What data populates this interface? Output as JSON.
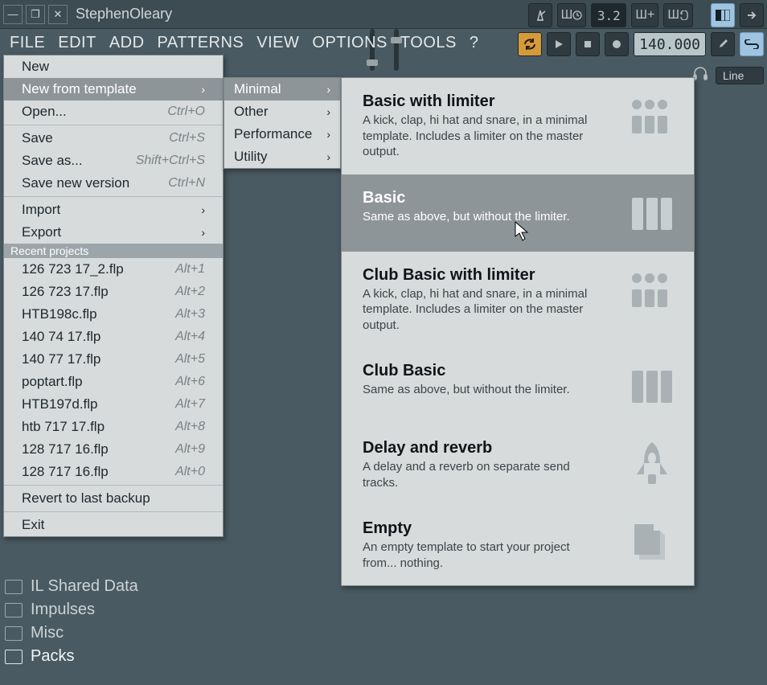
{
  "window": {
    "title": "StephenOleary",
    "min_glyph": "—",
    "max_glyph": "❐",
    "close_glyph": "✕"
  },
  "toolbar": {
    "tempo": "140.000",
    "pattern_display": "3.2",
    "output_label": "Line"
  },
  "menubar": [
    "FILE",
    "EDIT",
    "ADD",
    "PATTERNS",
    "VIEW",
    "OPTIONS",
    "TOOLS",
    "?"
  ],
  "file_menu": {
    "items": [
      {
        "label": "New",
        "key": "",
        "chev": false
      },
      {
        "label": "New from template",
        "key": "",
        "chev": true,
        "highlight": true
      },
      {
        "label": "Open...",
        "key": "Ctrl+O",
        "chev": false
      },
      {
        "sep": true
      },
      {
        "label": "Save",
        "key": "Ctrl+S",
        "chev": false
      },
      {
        "label": "Save as...",
        "key": "Shift+Ctrl+S",
        "chev": false
      },
      {
        "label": "Save new version",
        "key": "Ctrl+N",
        "chev": false
      },
      {
        "sep": true
      },
      {
        "label": "Import",
        "key": "",
        "chev": true
      },
      {
        "label": "Export",
        "key": "",
        "chev": true
      },
      {
        "section": "Recent projects"
      },
      {
        "label": "126 723 17_2.flp",
        "key": "Alt+1",
        "chev": false
      },
      {
        "label": "126 723 17.flp",
        "key": "Alt+2",
        "chev": false
      },
      {
        "label": "HTB198c.flp",
        "key": "Alt+3",
        "chev": false
      },
      {
        "label": "140 74 17.flp",
        "key": "Alt+4",
        "chev": false
      },
      {
        "label": "140 77 17.flp",
        "key": "Alt+5",
        "chev": false
      },
      {
        "label": "poptart.flp",
        "key": "Alt+6",
        "chev": false
      },
      {
        "label": "HTB197d.flp",
        "key": "Alt+7",
        "chev": false
      },
      {
        "label": "htb 717 17.flp",
        "key": "Alt+8",
        "chev": false
      },
      {
        "label": "128 717 16.flp",
        "key": "Alt+9",
        "chev": false
      },
      {
        "label": "128 717 16.flp",
        "key": "Alt+0",
        "chev": false
      },
      {
        "sep": true
      },
      {
        "label": "Revert to last backup",
        "key": "",
        "chev": false
      },
      {
        "sep": true
      },
      {
        "label": "Exit",
        "key": "",
        "chev": false
      }
    ]
  },
  "template_categories": [
    {
      "label": "Minimal",
      "highlight": true
    },
    {
      "label": "Other",
      "highlight": false
    },
    {
      "label": "Performance",
      "highlight": false
    },
    {
      "label": "Utility",
      "highlight": false
    }
  ],
  "templates": [
    {
      "title": "Basic with limiter",
      "desc": "A kick, clap, hi hat and snare, in a minimal template. Includes a limiter on the master output.",
      "icon": "drum"
    },
    {
      "title": "Basic",
      "desc": "Same as above, but without the limiter.",
      "icon": "bars",
      "highlight": true
    },
    {
      "title": "Club Basic with limiter",
      "desc": "A kick, clap, hi hat and snare, in a minimal template. Includes a limiter on the master output.",
      "icon": "drum"
    },
    {
      "title": "Club Basic",
      "desc": "Same as above, but without the limiter.",
      "icon": "bars"
    },
    {
      "title": "Delay and reverb",
      "desc": "A delay and a reverb on separate send tracks.",
      "icon": "rocket"
    },
    {
      "title": "Empty",
      "desc": "An empty template to start your project from... nothing.",
      "icon": "file"
    }
  ],
  "browser": [
    {
      "label": "IL Shared Data",
      "active": false
    },
    {
      "label": "Impulses",
      "active": false
    },
    {
      "label": "Misc",
      "active": false
    },
    {
      "label": "Packs",
      "active": true
    }
  ]
}
